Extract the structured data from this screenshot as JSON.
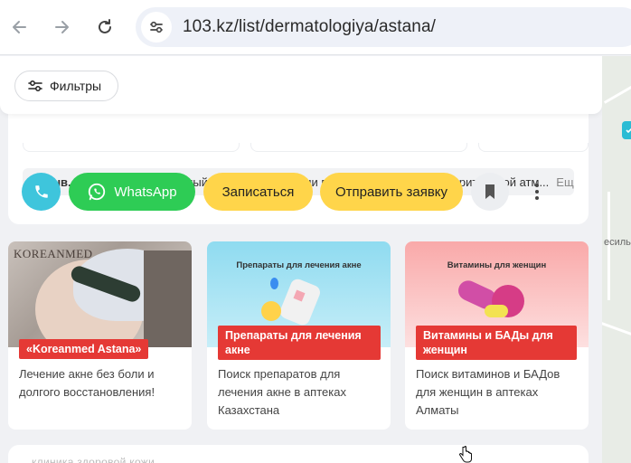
{
  "browser": {
    "url": "103.kz/list/dermatologiya/astana/"
  },
  "filters": {
    "button_label": "Фильтры"
  },
  "review": {
    "label": "Отзыв.",
    "text": "Невероятно позитивный врач! Консультации проходят в лёгкой и доверительной атм...",
    "more": "Еще"
  },
  "actions": {
    "whatsapp_label": "WhatsApp",
    "book_label": "Записаться",
    "request_label": "Отправить заявку"
  },
  "promos": [
    {
      "image_brand": "KOREANMED",
      "tag": "«Koreanmed Astana»",
      "description": "Лечение акне без боли и долгого восстановления!"
    },
    {
      "image_title": "Препараты для лечения акне",
      "tag": "Препараты для лечения акне",
      "description": "Поиск препаратов для лечения акне в аптеках Казахстана"
    },
    {
      "image_title": "Витамины для женщин",
      "tag": "Витамины и БАДы для женщин",
      "description": "Поиск витаминов и БАДов для женщин в аптеках Алматы"
    }
  ],
  "next_card": {
    "title": "клиника здоровой кожи"
  },
  "map": {
    "label": "есиль"
  },
  "colors": {
    "phone": "#3ec5dc",
    "whatsapp": "#2ecc55",
    "yellow": "#ffd54a",
    "tag_red": "#e53935",
    "promo2_bg": "#9fe2f3",
    "promo3_bg": "#fbb7b7"
  }
}
